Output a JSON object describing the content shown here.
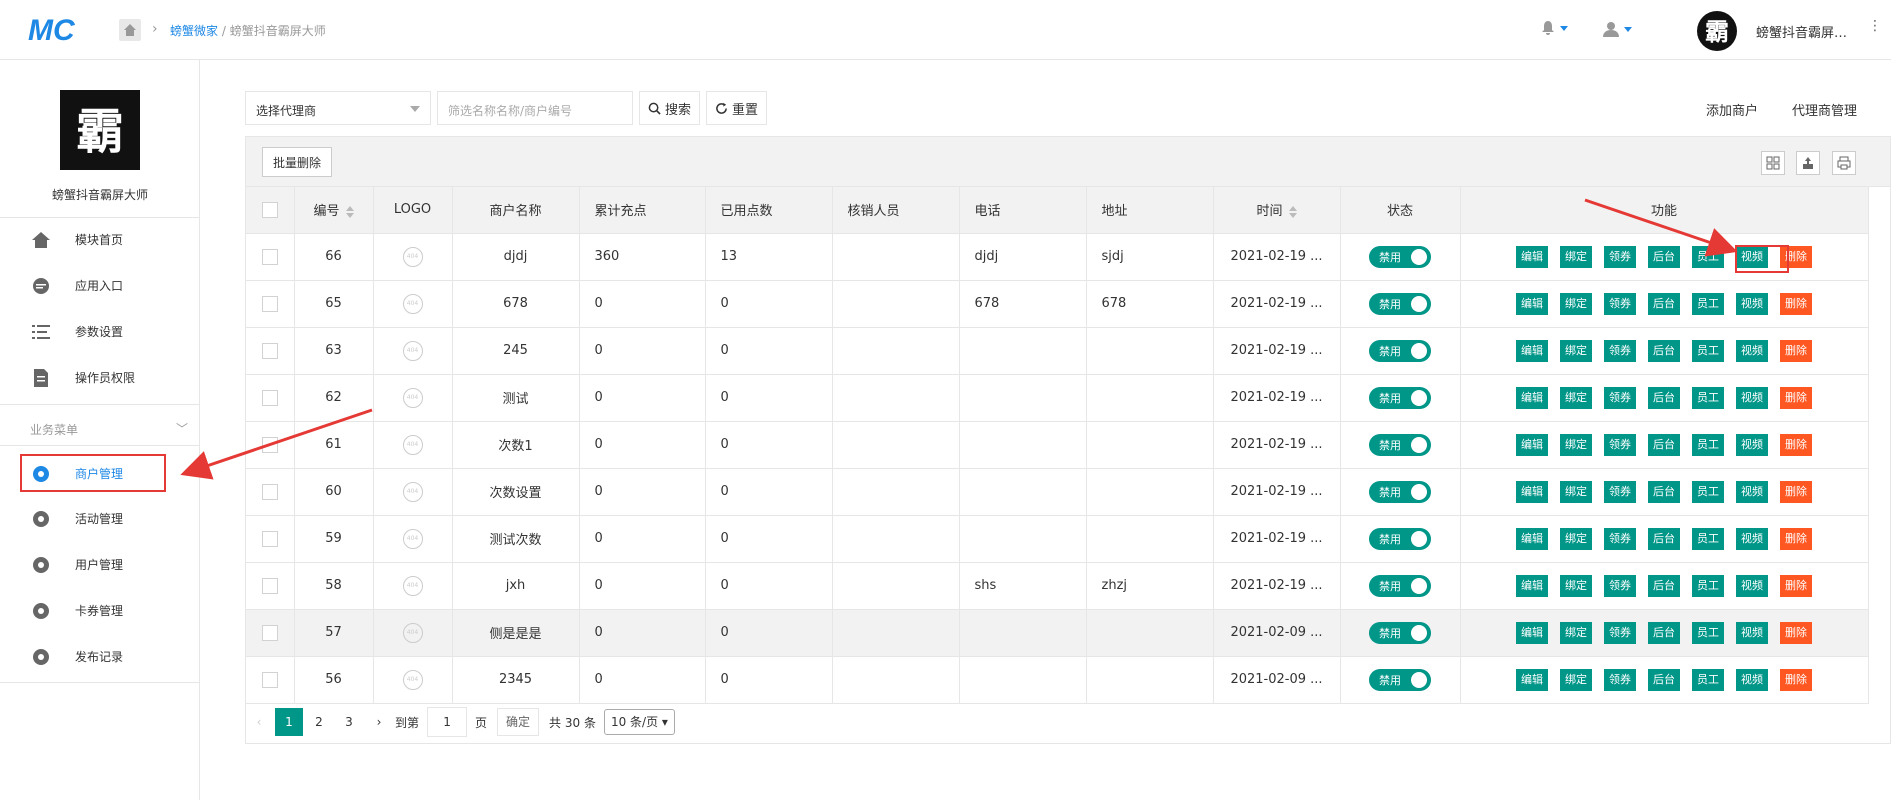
{
  "topbar": {
    "logo_text": "MC",
    "breadcrumb_link": "螃蟹微家",
    "breadcrumb_current": " / 螃蟹抖音霸屏大师",
    "user_name": "螃蟹抖音霸屏…",
    "avatar_glyph": "霸"
  },
  "sidebar": {
    "avatar_glyph": "霸",
    "store_name": "螃蟹抖音霸屏大师",
    "top_items": [
      {
        "label": "模块首页",
        "icon": "home-icon"
      },
      {
        "label": "应用入口",
        "icon": "chat-icon"
      },
      {
        "label": "参数设置",
        "icon": "list-icon"
      },
      {
        "label": "操作员权限",
        "icon": "document-icon"
      }
    ],
    "section_title": "业务菜单",
    "biz_items": [
      {
        "label": "商户管理",
        "icon": "gear-icon",
        "active": true
      },
      {
        "label": "活动管理",
        "icon": "gear-icon"
      },
      {
        "label": "用户管理",
        "icon": "gear-icon"
      },
      {
        "label": "卡券管理",
        "icon": "gear-icon"
      },
      {
        "label": "发布记录",
        "icon": "gear-icon"
      }
    ]
  },
  "filters": {
    "agent_select": "选择代理商",
    "search_placeholder": "筛选名称名称/商户编号",
    "search_label": "搜索",
    "reset_label": "重置"
  },
  "right_links": {
    "add_merchant": "添加商户",
    "agent_manage": "代理商管理"
  },
  "toolbar": {
    "batch_delete": "批量删除"
  },
  "table": {
    "headers": [
      "编号",
      "LOGO",
      "商户名称",
      "累计充点",
      "已用点数",
      "核销人员",
      "电话",
      "地址",
      "时间",
      "状态",
      "功能"
    ],
    "switch_label": "禁用",
    "actions": [
      "编辑",
      "绑定",
      "领券",
      "后台",
      "员工",
      "视频",
      "删除"
    ],
    "logo_placeholder": "404",
    "rows": [
      {
        "id": "66",
        "name": "djdj",
        "total": "360",
        "used": "13",
        "staff": "",
        "phone": "djdj",
        "addr": "sjdj",
        "time": "2021-02-19 ..."
      },
      {
        "id": "65",
        "name": "678",
        "total": "0",
        "used": "0",
        "staff": "",
        "phone": "678",
        "addr": "678",
        "time": "2021-02-19 ..."
      },
      {
        "id": "63",
        "name": "245",
        "total": "0",
        "used": "0",
        "staff": "",
        "phone": "",
        "addr": "",
        "time": "2021-02-19 ..."
      },
      {
        "id": "62",
        "name": "测试",
        "total": "0",
        "used": "0",
        "staff": "",
        "phone": "",
        "addr": "",
        "time": "2021-02-19 ..."
      },
      {
        "id": "61",
        "name": "次数1",
        "total": "0",
        "used": "0",
        "staff": "",
        "phone": "",
        "addr": "",
        "time": "2021-02-19 ..."
      },
      {
        "id": "60",
        "name": "次数设置",
        "total": "0",
        "used": "0",
        "staff": "",
        "phone": "",
        "addr": "",
        "time": "2021-02-19 ..."
      },
      {
        "id": "59",
        "name": "测试次数",
        "total": "0",
        "used": "0",
        "staff": "",
        "phone": "",
        "addr": "",
        "time": "2021-02-19 ..."
      },
      {
        "id": "58",
        "name": "jxh",
        "total": "0",
        "used": "0",
        "staff": "",
        "phone": "shs",
        "addr": "zhzj",
        "time": "2021-02-19 ..."
      },
      {
        "id": "57",
        "name": "侧是是是",
        "total": "0",
        "used": "0",
        "staff": "",
        "phone": "",
        "addr": "",
        "time": "2021-02-09 ..."
      },
      {
        "id": "56",
        "name": "2345",
        "total": "0",
        "used": "0",
        "staff": "",
        "phone": "",
        "addr": "",
        "time": "2021-02-09 ..."
      }
    ]
  },
  "pager": {
    "pages": [
      "1",
      "2",
      "3"
    ],
    "goto_label": "到第",
    "page_input": "1",
    "page_unit": "页",
    "confirm": "确定",
    "total": "共 30 条",
    "per_page": "10 条/页"
  }
}
